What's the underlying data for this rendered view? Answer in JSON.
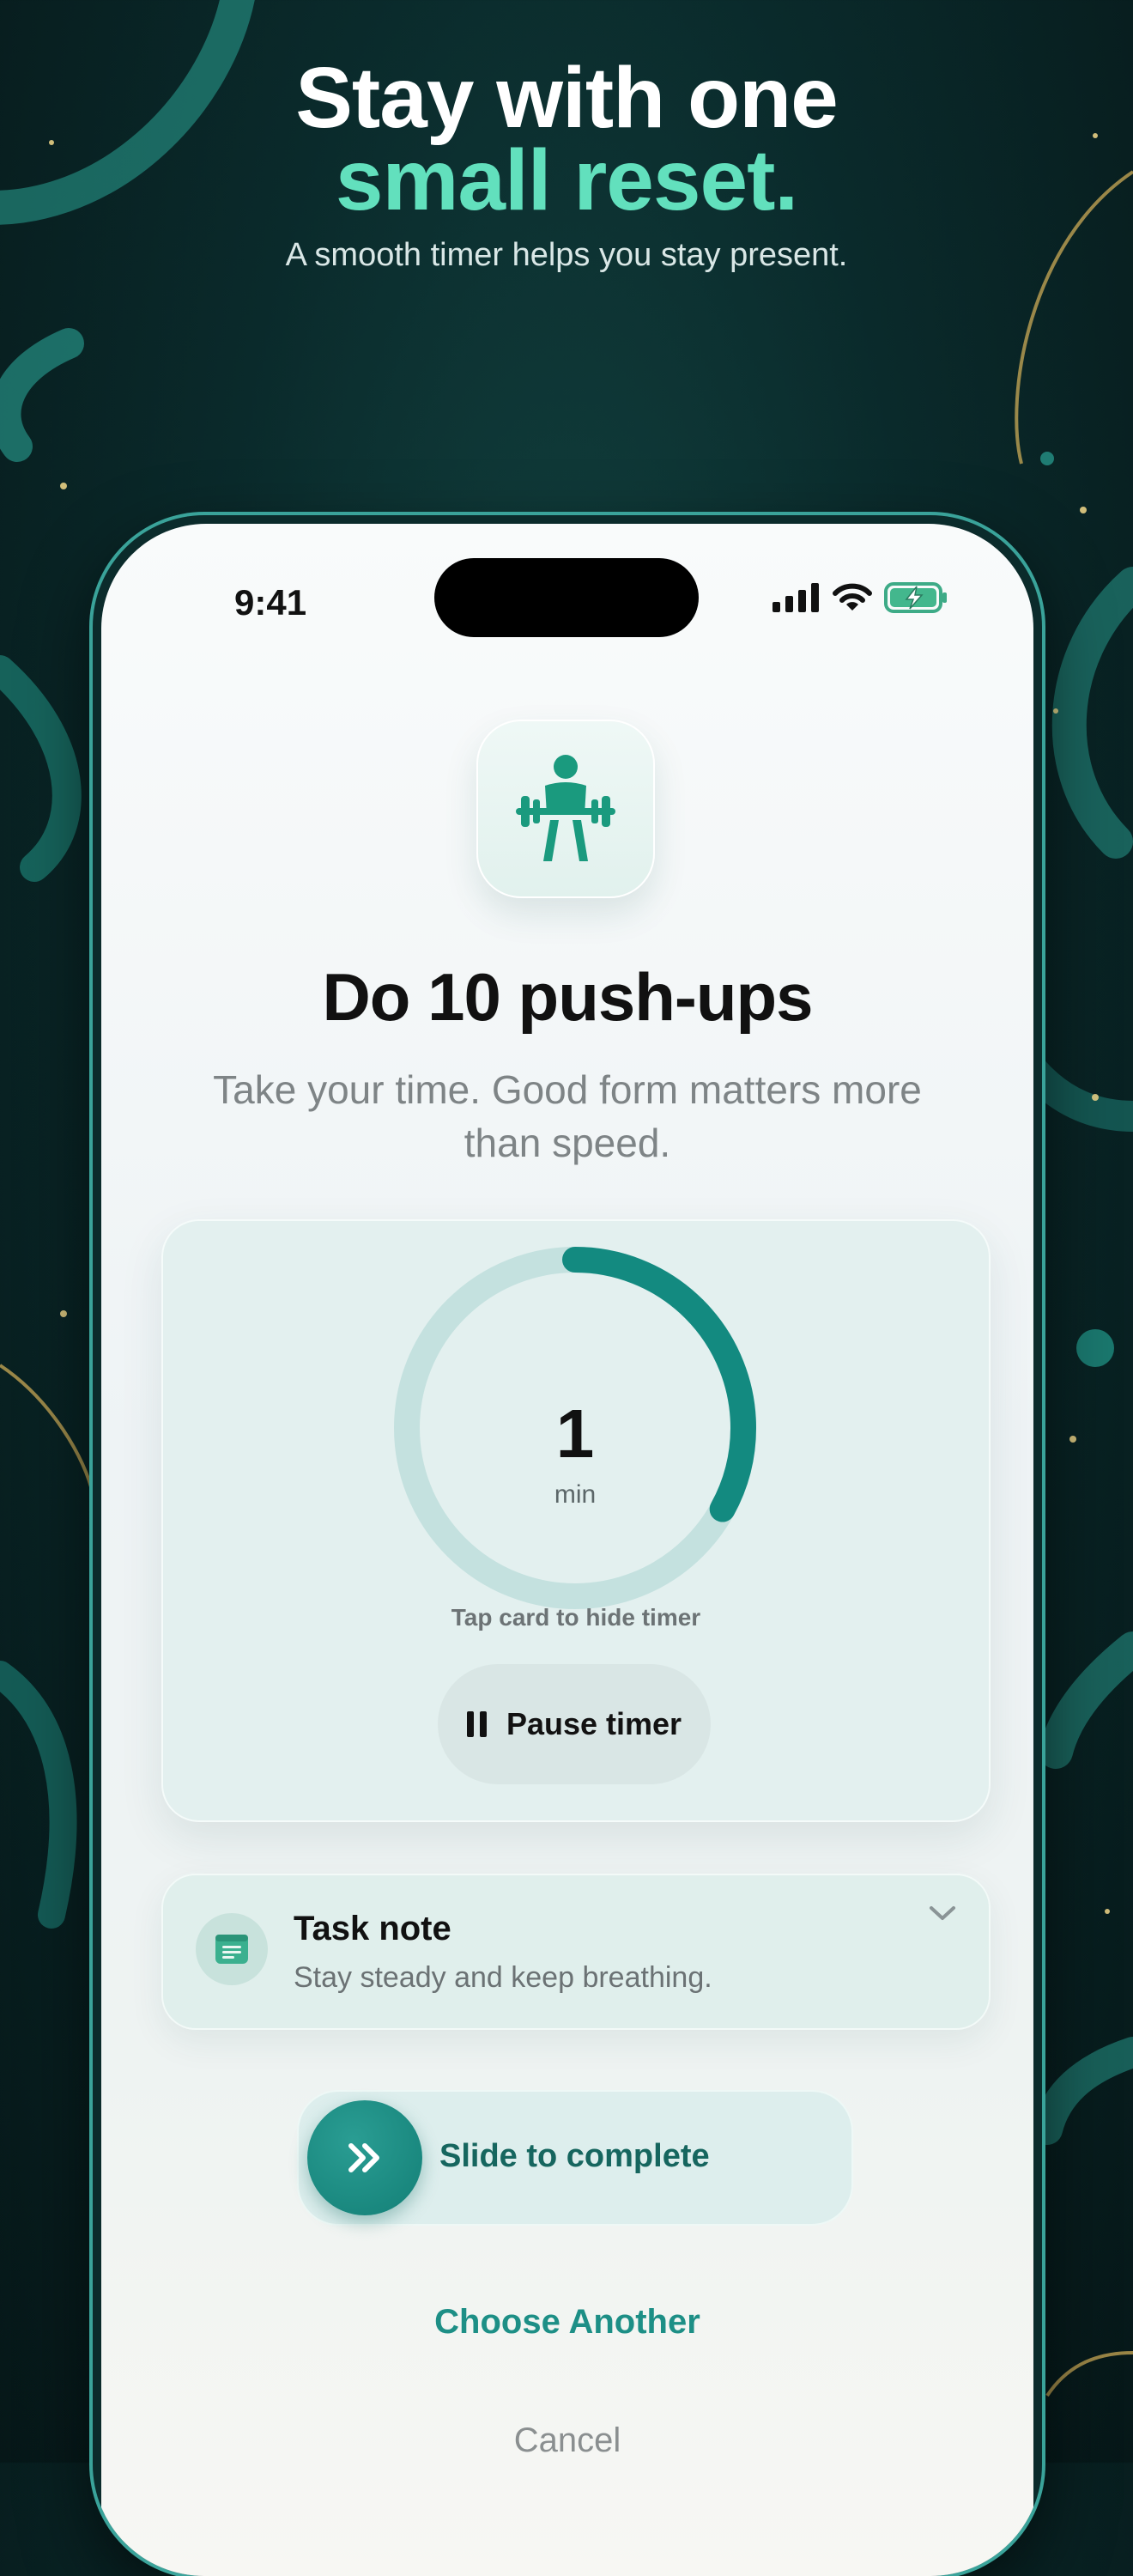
{
  "header": {
    "title_line1": "Stay with one",
    "title_line2": "small reset.",
    "subtitle": "A smooth timer helps you stay present."
  },
  "status_bar": {
    "time": "9:41",
    "icons": [
      "signal-icon",
      "wifi-icon",
      "battery-charging-icon"
    ]
  },
  "task": {
    "icon": "weightlifter-icon",
    "title": "Do 10 push-ups",
    "description": "Take your time. Good form matters more than speed."
  },
  "timer": {
    "value": "1",
    "unit": "min",
    "progress_fraction": 0.33,
    "hint": "Tap card to hide timer",
    "pause_label": "Pause timer"
  },
  "note": {
    "title": "Task note",
    "text": "Stay steady and keep breathing."
  },
  "actions": {
    "slide_label": "Slide to complete",
    "choose_another": "Choose Another",
    "cancel": "Cancel"
  },
  "colors": {
    "accent": "#1d8f86",
    "headline_accent": "#62e0bd",
    "ring_track": "#c4e1df",
    "ring_progress": "#138a80"
  }
}
